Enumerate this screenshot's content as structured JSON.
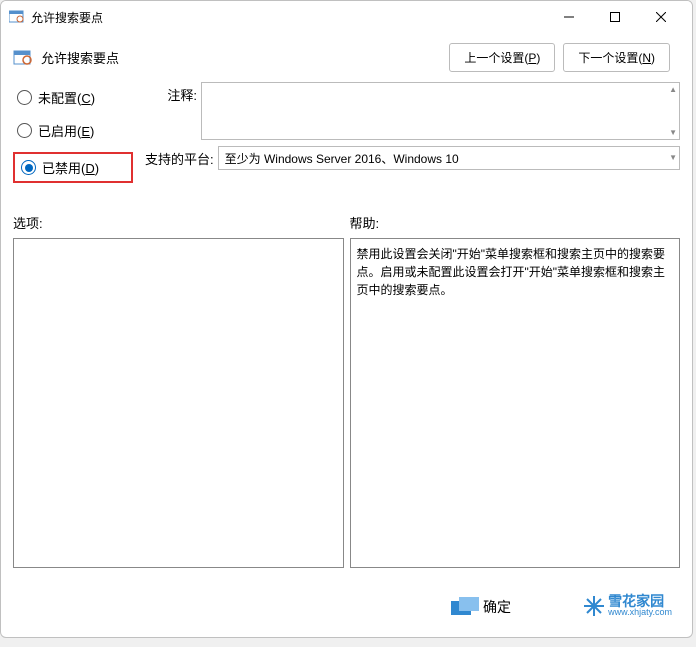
{
  "titlebar": {
    "title": "允许搜索要点"
  },
  "subtitle": {
    "text": "允许搜索要点"
  },
  "nav": {
    "prev": "上一个设置(P)",
    "next": "下一个设置(N)"
  },
  "radios": {
    "unconfigured": "未配置(C)",
    "enabled": "已启用(E)",
    "disabled": "已禁用(D)",
    "selected": "disabled"
  },
  "form": {
    "notes_label": "注释:",
    "notes_value": "",
    "platform_label": "支持的平台:",
    "platform_value": "至少为 Windows Server 2016、Windows 10"
  },
  "bottom": {
    "options_label": "选项:",
    "help_label": "帮助:",
    "help_text": "禁用此设置会关闭\"开始\"菜单搜索框和搜索主页中的搜索要点。启用或未配置此设置会打开\"开始\"菜单搜索框和搜索主页中的搜索要点。"
  },
  "footer": {
    "ok": "确定",
    "watermark": "雪花家园",
    "watermark_sub": "www.xhjaty.com"
  }
}
